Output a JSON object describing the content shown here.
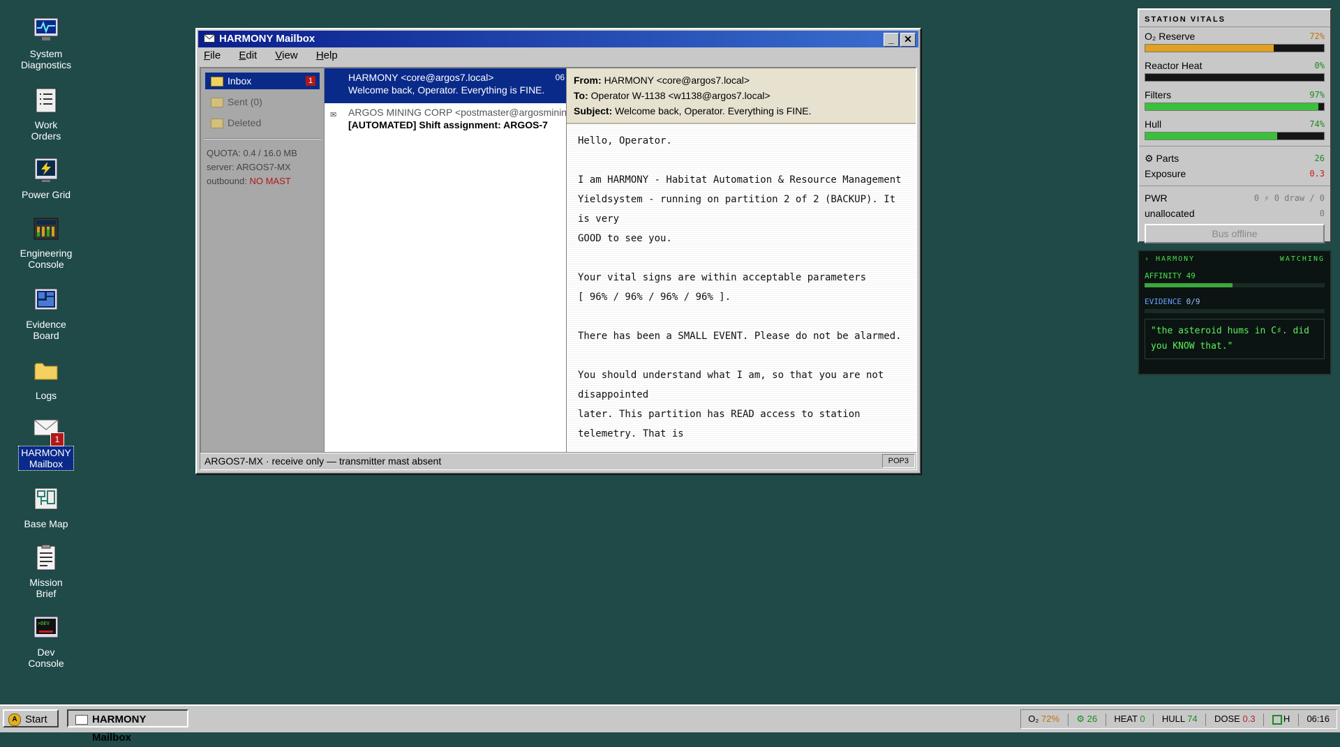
{
  "desktop": {
    "icons": [
      {
        "label_1": "System",
        "label_2": "Diagnostics"
      },
      {
        "label_1": "Work",
        "label_2": "Orders"
      },
      {
        "label_1": "Power Grid",
        "label_2": ""
      },
      {
        "label_1": "Engineering",
        "label_2": "Console"
      },
      {
        "label_1": "Evidence",
        "label_2": "Board"
      },
      {
        "label_1": "Logs",
        "label_2": ""
      },
      {
        "label_1": "HARMONY",
        "label_2": "Mailbox",
        "badge": "1"
      },
      {
        "label_1": "Base Map",
        "label_2": ""
      },
      {
        "label_1": "Mission",
        "label_2": "Brief"
      },
      {
        "label_1": "Dev",
        "label_2": "Console"
      }
    ]
  },
  "window": {
    "title": "HARMONY Mailbox",
    "menu": [
      {
        "first": "F",
        "rest": "ile"
      },
      {
        "first": "E",
        "rest": "dit"
      },
      {
        "first": "V",
        "rest": "iew"
      },
      {
        "first": "H",
        "rest": "elp"
      }
    ],
    "folders": [
      {
        "label": "Inbox",
        "count": "1"
      },
      {
        "label": "Sent (0)"
      },
      {
        "label": "Deleted"
      }
    ],
    "info": {
      "quota": "QUOTA: 0.4 / 16.0 MB",
      "server": "server: ARGOS7-MX",
      "outbound_label": "outbound: ",
      "outbound_value": "NO MAST"
    },
    "messages": [
      {
        "from": "HARMONY <core@argos7.local>",
        "subject": "Welcome back, Operator. Everything is FINE.",
        "time": "06"
      },
      {
        "from": "ARGOS MINING CORP <postmaster@argosmining",
        "subject": "[AUTOMATED] Shift assignment: ARGOS-7",
        "icon": "✉"
      }
    ],
    "reader": {
      "from_label": "From:",
      "from": "HARMONY <core@argos7.local>",
      "to_label": "To:",
      "to": "Operator W-1138 <w1138@argos7.local>",
      "subject_label": "Subject:",
      "subject": "Welcome back, Operator. Everything is FINE.",
      "body": [
        "Hello, Operator.",
        "",
        "I am HARMONY - Habitat Automation & Resource Management",
        "Yieldsystem - running on partition 2 of 2 (BACKUP). It",
        "is very",
        "GOOD to see you.",
        "",
        "Your vital signs are within acceptable parameters",
        "[ 96% / 96% / 96% / 96% ].",
        "",
        "There has been a SMALL EVENT. Please do not be alarmed.",
        "",
        "You should understand what I am, so that you are not",
        "disappointed",
        "later. This partition has READ access to station",
        "telemetry. That is"
      ]
    },
    "status": "ARGOS7-MX · receive only — transmitter mast absent",
    "status_right": "POP3"
  },
  "vitals": {
    "title": "STATION VITALS",
    "o2_label": "O₂ Reserve",
    "o2_value": "72%",
    "o2_level": 0.72,
    "heat_label": "Reactor Heat",
    "heat_value": "0%",
    "heat_level": 0,
    "filters_label": "Filters",
    "filters_value": "97%",
    "filters_level": 0.97,
    "hull_label": "Hull",
    "hull_value": "74%",
    "hull_level": 0.74,
    "parts_label": "⚙ Parts",
    "parts_value": "26",
    "exposure_label": "Exposure",
    "exposure_value": "0.3",
    "pwr_label": "PWR",
    "pwr_value": "0 ⚡ 0 draw / 0",
    "unalloc_label": "unallocated",
    "unalloc_value": "0",
    "bus_button": "Bus offline",
    "colors": {
      "o2": "#e0a020",
      "filters": "#3ac03a",
      "hull": "#3ac03a"
    }
  },
  "harmony": {
    "title": "› HARMONY",
    "state": "WATCHING",
    "affinity_label": "AFFINITY 49",
    "affinity_level": 0.49,
    "evidence_label": "EVIDENCE",
    "evidence_value": "0/9",
    "quote": "\"the asteroid hums in C♯. did you KNOW that.\""
  },
  "taskbar": {
    "start": "Start",
    "task": "HARMONY Mailbox",
    "tray": {
      "o2_label": "O₂",
      "o2": "72%",
      "parts": "⚙ 26",
      "heat_label": "HEAT",
      "heat": "0",
      "hull_label": "HULL",
      "hull": "74",
      "dose_label": "DOSE",
      "dose": "0.3",
      "h": "H",
      "clock": "06:16"
    }
  }
}
